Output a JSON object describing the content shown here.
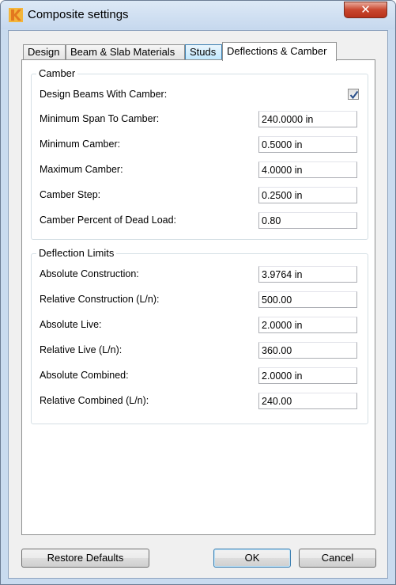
{
  "window": {
    "title": "Composite settings",
    "close_label": "✕"
  },
  "tabs": [
    {
      "label": "Design"
    },
    {
      "label": "Beam & Slab Materials"
    },
    {
      "label": "Studs"
    },
    {
      "label": "Deflections & Camber"
    }
  ],
  "camber": {
    "title": "Camber",
    "design_with_camber": {
      "label": "Design Beams With Camber:",
      "checked": true
    },
    "fields": [
      {
        "label": "Minimum Span To Camber:",
        "value": "240.0000 in"
      },
      {
        "label": "Minimum Camber:",
        "value": "0.5000 in"
      },
      {
        "label": "Maximum Camber:",
        "value": "4.0000 in"
      },
      {
        "label": "Camber Step:",
        "value": "0.2500 in"
      },
      {
        "label": "Camber Percent of Dead Load:",
        "value": "0.80"
      }
    ]
  },
  "deflection_limits": {
    "title": "Deflection Limits",
    "fields": [
      {
        "label": "Absolute Construction:",
        "value": "3.9764 in"
      },
      {
        "label": "Relative Construction (L/n):",
        "value": "500.00"
      },
      {
        "label": "Absolute Live:",
        "value": "2.0000 in"
      },
      {
        "label": "Relative Live (L/n):",
        "value": "360.00"
      },
      {
        "label": "Absolute Combined:",
        "value": "2.0000 in"
      },
      {
        "label": "Relative Combined (L/n):",
        "value": "240.00"
      }
    ]
  },
  "buttons": {
    "restore_defaults": "Restore Defaults",
    "ok": "OK",
    "cancel": "Cancel"
  },
  "icons": {
    "app": "app-logo-icon",
    "close": "close-icon",
    "check": "checkmark-icon"
  }
}
